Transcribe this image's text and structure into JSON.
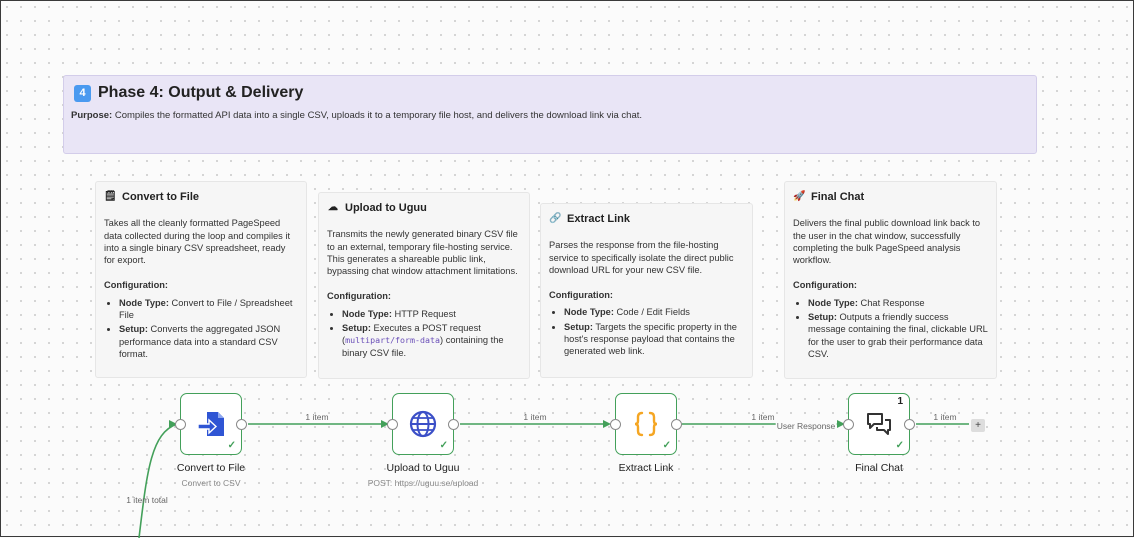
{
  "phase": {
    "badge": "4",
    "title": "Phase 4: Output & Delivery",
    "purpose_label": "Purpose:",
    "purpose_text": " Compiles the formatted API data into a single CSV, uploads it to a temporary file host, and delivers the download link via chat."
  },
  "cards": [
    {
      "icon": "document-icon",
      "glyph": "🗒",
      "title": "Convert to File",
      "description": "Takes all the cleanly formatted PageSpeed data collected during the loop and compiles it into a single binary CSV spreadsheet, ready for export.",
      "config_label": "Configuration:",
      "node_type_label": "Node Type:",
      "node_type": " Convert to File / Spreadsheet File",
      "setup_label": "Setup:",
      "setup": " Converts the aggregated JSON performance data into a standard CSV format."
    },
    {
      "icon": "cloud-icon",
      "glyph": "☁",
      "title": "Upload to Uguu",
      "description": "Transmits the newly generated binary CSV file to an external, temporary file-hosting service. This generates a shareable public link, bypassing chat window attachment limitations.",
      "config_label": "Configuration:",
      "node_type_label": "Node Type:",
      "node_type": " HTTP Request",
      "setup_label": "Setup:",
      "setup_pre": " Executes a POST request (",
      "setup_code": "multipart/form-data",
      "setup_post": ") containing the binary CSV file."
    },
    {
      "icon": "link-icon",
      "glyph": "🔗",
      "title": "Extract Link",
      "description": "Parses the response from the file-hosting service to specifically isolate the direct public download URL for your new CSV file.",
      "config_label": "Configuration:",
      "node_type_label": "Node Type:",
      "node_type": " Code / Edit Fields",
      "setup_label": "Setup:",
      "setup": " Targets the specific property in the host's response payload that contains the generated web link."
    },
    {
      "icon": "rocket-icon",
      "glyph": "🚀",
      "title": "Final Chat",
      "description": "Delivers the final public download link back to the user in the chat window, successfully completing the bulk PageSpeed analysis workflow.",
      "config_label": "Configuration:",
      "node_type_label": "Node Type:",
      "node_type": " Chat Response",
      "setup_label": "Setup:",
      "setup": " Outputs a friendly success message containing the final, clickable URL for the user to grab their performance data CSV."
    }
  ],
  "nodes": [
    {
      "name": "Convert to File",
      "subtitle": "Convert to CSV",
      "icon": "file-convert-icon"
    },
    {
      "name": "Upload to Uguu",
      "subtitle": "POST: https://uguu.se/upload",
      "icon": "globe-icon"
    },
    {
      "name": "Extract Link",
      "subtitle": "",
      "icon": "code-braces-icon"
    },
    {
      "name": "Final Chat",
      "subtitle": "",
      "icon": "chat-icon",
      "count": "1"
    }
  ],
  "connections": {
    "incoming_label": "1 item total",
    "c1": "1 item",
    "c2": "1 item",
    "c3": "1 item",
    "c3_output": "User Response",
    "c4": "1 item",
    "add_symbol": "+"
  },
  "colors": {
    "success": "#43a05a",
    "phase_bg": "#e9e5f6",
    "badge": "#4a9af0",
    "convert_icon": "#2f55d4",
    "globe_icon": "#3b4fc7",
    "braces_icon": "#f5a623"
  }
}
